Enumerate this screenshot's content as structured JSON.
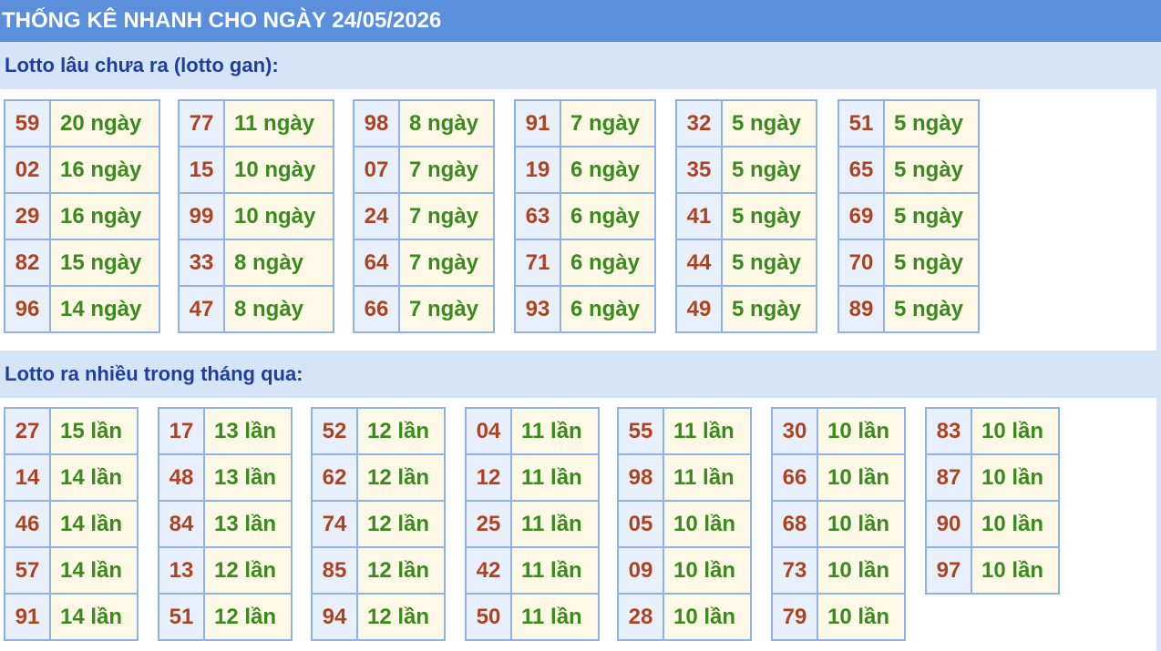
{
  "title": "THỐNG KÊ NHANH CHO NGÀY 24/05/2026",
  "gan": {
    "heading": "Lotto lâu chưa ra (lotto gan):",
    "groups": [
      [
        {
          "n": "59",
          "v": "20 ngày"
        },
        {
          "n": "02",
          "v": "16 ngày"
        },
        {
          "n": "29",
          "v": "16 ngày"
        },
        {
          "n": "82",
          "v": "15 ngày"
        },
        {
          "n": "96",
          "v": "14 ngày"
        }
      ],
      [
        {
          "n": "77",
          "v": "11 ngày"
        },
        {
          "n": "15",
          "v": "10 ngày"
        },
        {
          "n": "99",
          "v": "10 ngày"
        },
        {
          "n": "33",
          "v": "8 ngày"
        },
        {
          "n": "47",
          "v": "8 ngày"
        }
      ],
      [
        {
          "n": "98",
          "v": "8 ngày"
        },
        {
          "n": "07",
          "v": "7 ngày"
        },
        {
          "n": "24",
          "v": "7 ngày"
        },
        {
          "n": "64",
          "v": "7 ngày"
        },
        {
          "n": "66",
          "v": "7 ngày"
        }
      ],
      [
        {
          "n": "91",
          "v": "7 ngày"
        },
        {
          "n": "19",
          "v": "6 ngày"
        },
        {
          "n": "63",
          "v": "6 ngày"
        },
        {
          "n": "71",
          "v": "6 ngày"
        },
        {
          "n": "93",
          "v": "6 ngày"
        }
      ],
      [
        {
          "n": "32",
          "v": "5 ngày"
        },
        {
          "n": "35",
          "v": "5 ngày"
        },
        {
          "n": "41",
          "v": "5 ngày"
        },
        {
          "n": "44",
          "v": "5 ngày"
        },
        {
          "n": "49",
          "v": "5 ngày"
        }
      ],
      [
        {
          "n": "51",
          "v": "5 ngày"
        },
        {
          "n": "65",
          "v": "5 ngày"
        },
        {
          "n": "69",
          "v": "5 ngày"
        },
        {
          "n": "70",
          "v": "5 ngày"
        },
        {
          "n": "89",
          "v": "5 ngày"
        }
      ]
    ]
  },
  "nhieu": {
    "heading": "Lotto ra nhiều trong tháng qua:",
    "groups": [
      [
        {
          "n": "27",
          "v": "15 lần"
        },
        {
          "n": "14",
          "v": "14 lần"
        },
        {
          "n": "46",
          "v": "14 lần"
        },
        {
          "n": "57",
          "v": "14 lần"
        },
        {
          "n": "91",
          "v": "14 lần"
        }
      ],
      [
        {
          "n": "17",
          "v": "13 lần"
        },
        {
          "n": "48",
          "v": "13 lần"
        },
        {
          "n": "84",
          "v": "13 lần"
        },
        {
          "n": "13",
          "v": "12 lần"
        },
        {
          "n": "51",
          "v": "12 lần"
        }
      ],
      [
        {
          "n": "52",
          "v": "12 lần"
        },
        {
          "n": "62",
          "v": "12 lần"
        },
        {
          "n": "74",
          "v": "12 lần"
        },
        {
          "n": "85",
          "v": "12 lần"
        },
        {
          "n": "94",
          "v": "12 lần"
        }
      ],
      [
        {
          "n": "04",
          "v": "11 lần"
        },
        {
          "n": "12",
          "v": "11 lần"
        },
        {
          "n": "25",
          "v": "11 lần"
        },
        {
          "n": "42",
          "v": "11 lần"
        },
        {
          "n": "50",
          "v": "11 lần"
        }
      ],
      [
        {
          "n": "55",
          "v": "11 lần"
        },
        {
          "n": "98",
          "v": "11 lần"
        },
        {
          "n": "05",
          "v": "10 lần"
        },
        {
          "n": "09",
          "v": "10 lần"
        },
        {
          "n": "28",
          "v": "10 lần"
        }
      ],
      [
        {
          "n": "30",
          "v": "10 lần"
        },
        {
          "n": "66",
          "v": "10 lần"
        },
        {
          "n": "68",
          "v": "10 lần"
        },
        {
          "n": "73",
          "v": "10 lần"
        },
        {
          "n": "79",
          "v": "10 lần"
        }
      ],
      [
        {
          "n": "83",
          "v": "10 lần"
        },
        {
          "n": "87",
          "v": "10 lần"
        },
        {
          "n": "90",
          "v": "10 lần"
        },
        {
          "n": "97",
          "v": "10 lần"
        }
      ]
    ]
  }
}
